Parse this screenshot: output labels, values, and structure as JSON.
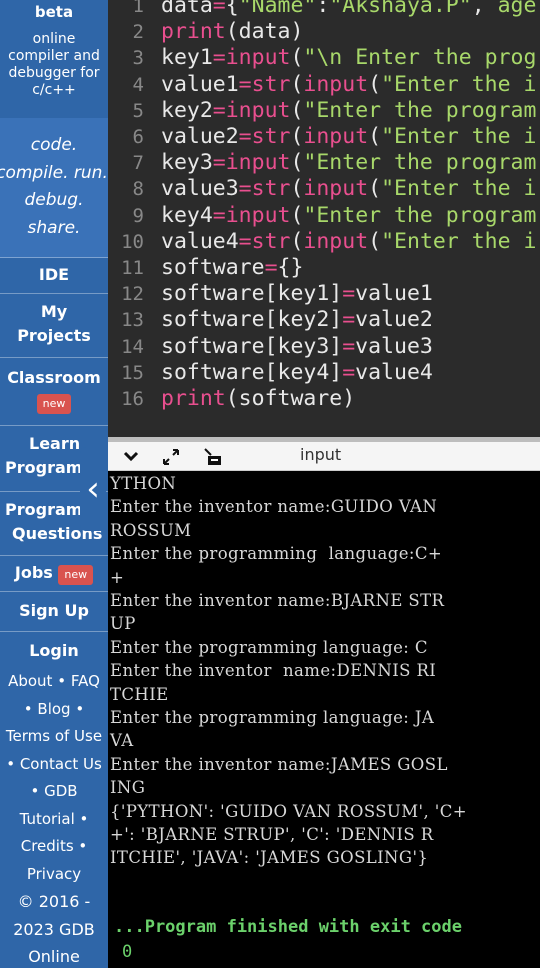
{
  "sidebar": {
    "beta": "beta",
    "desc": [
      "online",
      "compiler and",
      "debugger for",
      "c/c++"
    ],
    "motto": [
      "code.",
      "compile. run.",
      "debug.",
      "share."
    ],
    "nav": {
      "ide": "IDE",
      "my_projects": [
        "My",
        "Projects"
      ],
      "classroom": "Classroom",
      "classroom_badge": "new",
      "learn": [
        "Learn",
        "Programm"
      ],
      "questions": [
        "Programm",
        "Questions"
      ],
      "jobs": "Jobs",
      "jobs_badge": "new",
      "signup": "Sign Up",
      "login": "Login"
    },
    "links": {
      "about_faq": "About • FAQ",
      "blog": "• Blog •",
      "terms": "Terms of Use",
      "contact": "• Contact Us",
      "gdb": "• GDB",
      "tutorial": "Tutorial •",
      "credits": "Credits •",
      "privacy": "Privacy",
      "copyright1": "© 2016 -",
      "copyright2": "2023 GDB",
      "copyright3": "Online"
    }
  },
  "editor": {
    "lines": [
      {
        "n": "1",
        "tokens": [
          [
            "w",
            "data"
          ],
          [
            "k",
            "="
          ],
          [
            "w",
            "{"
          ],
          [
            "s",
            "\"Name\""
          ],
          [
            "w",
            ":"
          ],
          [
            "s",
            "\"Akshaya.P\""
          ],
          [
            "w",
            ", "
          ],
          [
            "s",
            "age"
          ]
        ]
      },
      {
        "n": "2",
        "tokens": [
          [
            "k",
            "print"
          ],
          [
            "w",
            "(data)"
          ]
        ]
      },
      {
        "n": "3",
        "tokens": [
          [
            "w",
            "key1"
          ],
          [
            "k",
            "="
          ],
          [
            "k",
            "input"
          ],
          [
            "w",
            "("
          ],
          [
            "s",
            "\"\\n Enter the prog"
          ]
        ]
      },
      {
        "n": "4",
        "tokens": [
          [
            "w",
            "value1"
          ],
          [
            "k",
            "="
          ],
          [
            "k",
            "str"
          ],
          [
            "w",
            "("
          ],
          [
            "k",
            "input"
          ],
          [
            "w",
            "("
          ],
          [
            "s",
            "\"Enter the i"
          ]
        ]
      },
      {
        "n": "5",
        "tokens": [
          [
            "w",
            "key2"
          ],
          [
            "k",
            "="
          ],
          [
            "k",
            "input"
          ],
          [
            "w",
            "("
          ],
          [
            "s",
            "\"Enter the program"
          ]
        ]
      },
      {
        "n": "6",
        "tokens": [
          [
            "w",
            "value2"
          ],
          [
            "k",
            "="
          ],
          [
            "k",
            "str"
          ],
          [
            "w",
            "("
          ],
          [
            "k",
            "input"
          ],
          [
            "w",
            "("
          ],
          [
            "s",
            "\"Enter the i"
          ]
        ]
      },
      {
        "n": "7",
        "tokens": [
          [
            "w",
            "key3"
          ],
          [
            "k",
            "="
          ],
          [
            "k",
            "input"
          ],
          [
            "w",
            "("
          ],
          [
            "s",
            "\"Enter the program"
          ]
        ]
      },
      {
        "n": "8",
        "tokens": [
          [
            "w",
            "value3"
          ],
          [
            "k",
            "="
          ],
          [
            "k",
            "str"
          ],
          [
            "w",
            "("
          ],
          [
            "k",
            "input"
          ],
          [
            "w",
            "("
          ],
          [
            "s",
            "\"Enter the i"
          ]
        ]
      },
      {
        "n": "9",
        "tokens": [
          [
            "w",
            "key4"
          ],
          [
            "k",
            "="
          ],
          [
            "k",
            "input"
          ],
          [
            "w",
            "("
          ],
          [
            "s",
            "\"Enter the program"
          ]
        ]
      },
      {
        "n": "10",
        "tokens": [
          [
            "w",
            "value4"
          ],
          [
            "k",
            "="
          ],
          [
            "k",
            "str"
          ],
          [
            "w",
            "("
          ],
          [
            "k",
            "input"
          ],
          [
            "w",
            "("
          ],
          [
            "s",
            "\"Enter the i"
          ]
        ]
      },
      {
        "n": "11",
        "tokens": [
          [
            "w",
            "software"
          ],
          [
            "k",
            "="
          ],
          [
            "w",
            "{}"
          ]
        ]
      },
      {
        "n": "12",
        "tokens": [
          [
            "w",
            "software[key1]"
          ],
          [
            "k",
            "="
          ],
          [
            "w",
            "value1"
          ]
        ]
      },
      {
        "n": "13",
        "tokens": [
          [
            "w",
            "software[key2]"
          ],
          [
            "k",
            "="
          ],
          [
            "w",
            "value2"
          ]
        ]
      },
      {
        "n": "14",
        "tokens": [
          [
            "w",
            "software[key3]"
          ],
          [
            "k",
            "="
          ],
          [
            "w",
            "value3"
          ]
        ]
      },
      {
        "n": "15",
        "tokens": [
          [
            "w",
            "software[key4]"
          ],
          [
            "k",
            "="
          ],
          [
            "w",
            "value4"
          ]
        ]
      },
      {
        "n": "16",
        "tokens": [
          [
            "k",
            "print"
          ],
          [
            "w",
            "(software)"
          ]
        ]
      }
    ]
  },
  "toolbar": {
    "title": "input",
    "icons": [
      "chevron-down-icon",
      "expand-icon",
      "terminal-icon"
    ]
  },
  "console": {
    "lines": [
      "YTHON",
      "Enter the inventor name:GUIDO VAN",
      "ROSSUM",
      "Enter the programming  language:C+",
      "+",
      "Enter the inventor name:BJARNE STR",
      "UP",
      "Enter the programming language: C",
      "Enter the inventor  name:DENNIS RI",
      "TCHIE",
      "Enter the programming language: JA",
      "VA",
      "Enter the inventor name:JAMES GOSL",
      "ING",
      "{'PYTHON': 'GUIDO VAN ROSSUM', 'C+",
      "+': 'BJARNE STRUP', 'C': 'DENNIS R",
      "ITCHIE', 'JAVA': 'JAMES GOSLING'}"
    ],
    "finish": "...Program finished with exit code",
    "exit_code": "0"
  }
}
